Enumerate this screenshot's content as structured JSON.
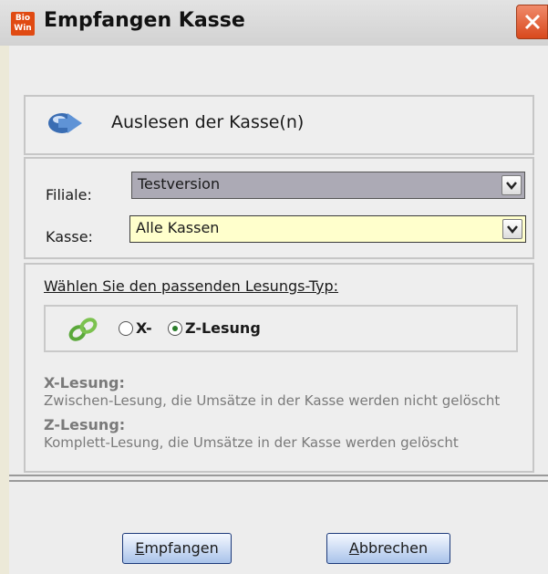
{
  "window": {
    "logo_text": "Bio Win",
    "title": "Empfangen Kasse"
  },
  "header": {
    "icon": "network-transfer-icon",
    "text": "Auslesen der Kasse(n)"
  },
  "form": {
    "filiale_label": "Filiale:",
    "filiale_value": "Testversion",
    "kasse_label": "Kasse:",
    "kasse_value": "Alle Kassen"
  },
  "lesung": {
    "choose_label": "Wählen Sie den passenden Lesungs-Typ:",
    "options": [
      {
        "label": "X-",
        "selected": false
      },
      {
        "label": "Z-Lesung",
        "selected": true
      }
    ],
    "x_title": "X-Lesung:",
    "x_desc": "Zwischen-Lesung, die Umsätze in der Kasse werden nicht gelöscht",
    "z_title": "Z-Lesung:",
    "z_desc": "Komplett-Lesung, die Umsätze in der Kasse werden gelöscht"
  },
  "buttons": {
    "ok_first": "E",
    "ok_rest": "mpfangen",
    "cancel_first": "A",
    "cancel_rest": "bbrechen"
  },
  "colors": {
    "accent": "#2b7d2b",
    "kasse_bg": "#ffffcc",
    "filiale_bg": "#acaab5"
  }
}
